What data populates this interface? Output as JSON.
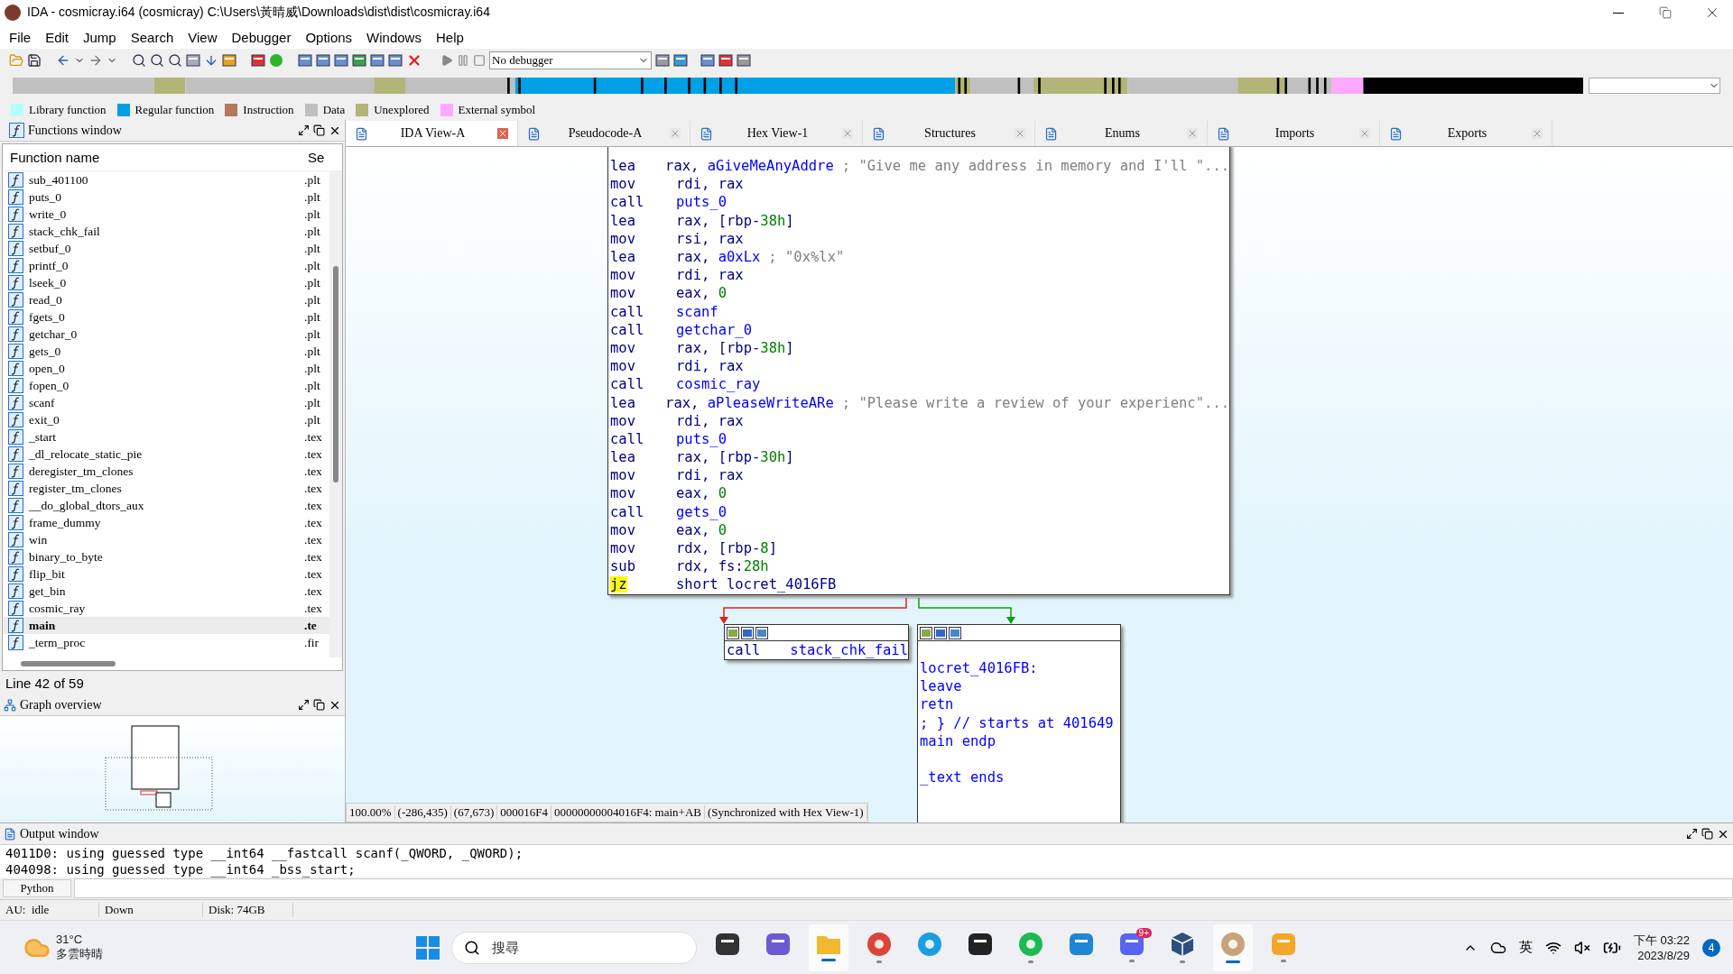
{
  "window": {
    "title": "IDA - cosmicray.i64 (cosmicray) C:\\Users\\黃晴威\\Downloads\\dist\\dist\\cosmicray.i64"
  },
  "menu": [
    "File",
    "Edit",
    "Jump",
    "Search",
    "View",
    "Debugger",
    "Options",
    "Windows",
    "Help"
  ],
  "toolbar": {
    "debugger": "No debugger"
  },
  "legend": [
    {
      "label": "Library function",
      "color": "#b4ffff"
    },
    {
      "label": "Regular function",
      "color": "#00a0e6"
    },
    {
      "label": "Instruction",
      "color": "#b4785a"
    },
    {
      "label": "Data",
      "color": "#c0c0c0"
    },
    {
      "label": "Unexplored",
      "color": "#b4b478"
    },
    {
      "label": "External symbol",
      "color": "#ffa8ff"
    }
  ],
  "functions_window": {
    "title": "Functions window",
    "columns": [
      "Function name",
      "Se"
    ],
    "rows": [
      {
        "name": "sub_401100",
        "segment": ".plt",
        "selected": false
      },
      {
        "name": "puts_0",
        "segment": ".plt",
        "selected": false
      },
      {
        "name": "write_0",
        "segment": ".plt",
        "selected": false
      },
      {
        "name": "stack_chk_fail",
        "segment": ".plt",
        "selected": false
      },
      {
        "name": "setbuf_0",
        "segment": ".plt",
        "selected": false
      },
      {
        "name": "printf_0",
        "segment": ".plt",
        "selected": false
      },
      {
        "name": "lseek_0",
        "segment": ".plt",
        "selected": false
      },
      {
        "name": "read_0",
        "segment": ".plt",
        "selected": false
      },
      {
        "name": "fgets_0",
        "segment": ".plt",
        "selected": false
      },
      {
        "name": "getchar_0",
        "segment": ".plt",
        "selected": false
      },
      {
        "name": "gets_0",
        "segment": ".plt",
        "selected": false
      },
      {
        "name": "open_0",
        "segment": ".plt",
        "selected": false
      },
      {
        "name": "fopen_0",
        "segment": ".plt",
        "selected": false
      },
      {
        "name": "scanf",
        "segment": ".plt",
        "selected": false
      },
      {
        "name": "exit_0",
        "segment": ".plt",
        "selected": false
      },
      {
        "name": "_start",
        "segment": ".tex",
        "selected": false
      },
      {
        "name": "_dl_relocate_static_pie",
        "segment": ".tex",
        "selected": false
      },
      {
        "name": "deregister_tm_clones",
        "segment": ".tex",
        "selected": false
      },
      {
        "name": "register_tm_clones",
        "segment": ".tex",
        "selected": false
      },
      {
        "name": "__do_global_dtors_aux",
        "segment": ".tex",
        "selected": false
      },
      {
        "name": "frame_dummy",
        "segment": ".tex",
        "selected": false
      },
      {
        "name": "win",
        "segment": ".tex",
        "selected": false
      },
      {
        "name": "binary_to_byte",
        "segment": ".tex",
        "selected": false
      },
      {
        "name": "flip_bit",
        "segment": ".tex",
        "selected": false
      },
      {
        "name": "get_bin",
        "segment": ".tex",
        "selected": false
      },
      {
        "name": "cosmic_ray",
        "segment": ".tex",
        "selected": false
      },
      {
        "name": "main",
        "segment": ".te",
        "selected": true
      },
      {
        "name": "_term_proc",
        "segment": ".fir",
        "selected": false
      }
    ],
    "status": "Line 42 of 59"
  },
  "graph_overview": {
    "title": "Graph overview"
  },
  "tabs": [
    {
      "label": "IDA View-A",
      "selected": true
    },
    {
      "label": "Pseudocode-A",
      "selected": false
    },
    {
      "label": "Hex View-1",
      "selected": false
    },
    {
      "label": "Structures",
      "selected": false
    },
    {
      "label": "Enums",
      "selected": false
    },
    {
      "label": "Imports",
      "selected": false
    },
    {
      "label": "Exports",
      "selected": false
    }
  ],
  "graph": {
    "main_block": {
      "lines": [
        {
          "op": "lea",
          "args": [
            {
              "text": "rax, ",
              "kind": "plain"
            },
            {
              "text": "aGiveMeAnyAddre",
              "kind": "name"
            }
          ],
          "comment": "; \"Give me any address in memory and I'll \"...",
          "highlighted": false
        },
        {
          "op": "mov",
          "args": [
            {
              "text": "rdi, rax",
              "kind": "plain"
            }
          ],
          "highlighted": false
        },
        {
          "op": "call",
          "args": [
            {
              "text": "puts_0",
              "kind": "name"
            }
          ],
          "highlighted": false
        },
        {
          "op": "lea",
          "args": [
            {
              "text": "rax, [rbp-",
              "kind": "plain"
            },
            {
              "text": "38h",
              "kind": "number"
            },
            {
              "text": "]",
              "kind": "plain"
            }
          ],
          "highlighted": false
        },
        {
          "op": "mov",
          "args": [
            {
              "text": "rsi, rax",
              "kind": "plain"
            }
          ],
          "highlighted": false
        },
        {
          "op": "lea",
          "args": [
            {
              "text": "rax, ",
              "kind": "plain"
            },
            {
              "text": "a0xLx",
              "kind": "name"
            }
          ],
          "comment": "; \"0x%lx\"",
          "highlighted": false
        },
        {
          "op": "mov",
          "args": [
            {
              "text": "rdi, rax",
              "kind": "plain"
            }
          ],
          "highlighted": false
        },
        {
          "op": "mov",
          "args": [
            {
              "text": "eax, ",
              "kind": "plain"
            },
            {
              "text": "0",
              "kind": "number"
            }
          ],
          "highlighted": false
        },
        {
          "op": "call",
          "args": [
            {
              "text": "scanf",
              "kind": "name"
            }
          ],
          "highlighted": false
        },
        {
          "op": "call",
          "args": [
            {
              "text": "getchar_0",
              "kind": "name"
            }
          ],
          "highlighted": false
        },
        {
          "op": "mov",
          "args": [
            {
              "text": "rax, [rbp-",
              "kind": "plain"
            },
            {
              "text": "38h",
              "kind": "number"
            },
            {
              "text": "]",
              "kind": "plain"
            }
          ],
          "highlighted": false
        },
        {
          "op": "mov",
          "args": [
            {
              "text": "rdi, rax",
              "kind": "plain"
            }
          ],
          "highlighted": false
        },
        {
          "op": "call",
          "args": [
            {
              "text": "cosmic_ray",
              "kind": "name"
            }
          ],
          "highlighted": false
        },
        {
          "op": "lea",
          "args": [
            {
              "text": "rax, ",
              "kind": "plain"
            },
            {
              "text": "aPleaseWriteARe",
              "kind": "name"
            }
          ],
          "comment": "; \"Please write a review of your experienc\"...",
          "highlighted": false
        },
        {
          "op": "mov",
          "args": [
            {
              "text": "rdi, rax",
              "kind": "plain"
            }
          ],
          "highlighted": false
        },
        {
          "op": "call",
          "args": [
            {
              "text": "puts_0",
              "kind": "name"
            }
          ],
          "highlighted": false
        },
        {
          "op": "lea",
          "args": [
            {
              "text": "rax, [rbp-",
              "kind": "plain"
            },
            {
              "text": "30h",
              "kind": "number"
            },
            {
              "text": "]",
              "kind": "plain"
            }
          ],
          "highlighted": false
        },
        {
          "op": "mov",
          "args": [
            {
              "text": "rdi, rax",
              "kind": "plain"
            }
          ],
          "highlighted": false
        },
        {
          "op": "mov",
          "args": [
            {
              "text": "eax, ",
              "kind": "plain"
            },
            {
              "text": "0",
              "kind": "number"
            }
          ],
          "highlighted": false
        },
        {
          "op": "call",
          "args": [
            {
              "text": "gets_0",
              "kind": "name"
            }
          ],
          "highlighted": false
        },
        {
          "op": "mov",
          "args": [
            {
              "text": "eax, ",
              "kind": "plain"
            },
            {
              "text": "0",
              "kind": "number"
            }
          ],
          "highlighted": false
        },
        {
          "op": "mov",
          "args": [
            {
              "text": "rdx, [rbp-",
              "kind": "plain"
            },
            {
              "text": "8",
              "kind": "number"
            },
            {
              "text": "]",
              "kind": "plain"
            }
          ],
          "highlighted": false
        },
        {
          "op": "sub",
          "args": [
            {
              "text": "rdx, fs:",
              "kind": "plain"
            },
            {
              "text": "28h",
              "kind": "number"
            }
          ],
          "highlighted": false
        },
        {
          "op": "jz",
          "args": [
            {
              "text": "short locret_4016FB",
              "kind": "plain"
            }
          ],
          "highlighted": true
        }
      ]
    },
    "fail_block": {
      "op": "call",
      "arg": "stack_chk_fail"
    },
    "ret_block": {
      "groups": [
        {
          "lines": [
            "locret_4016FB:",
            "leave",
            "retn",
            "; } // starts at 401649",
            "main endp"
          ]
        },
        {
          "lines": [
            "_text ends"
          ]
        }
      ]
    },
    "status": [
      "100.00%",
      "(-286,435)",
      "(67,673)",
      "000016F4",
      "00000000004016F4: main+AB",
      "(Synchronized with Hex View-1)"
    ]
  },
  "output_window": {
    "title": "Output window",
    "lines": [
      "4011D0: using guessed type __int64 __fastcall scanf(_QWORD, _QWORD);",
      "404098: using guessed type __int64 _bss_start;"
    ],
    "button": "Python"
  },
  "status_bar": [
    "AU:  idle",
    "Down",
    "Disk: 74GB"
  ],
  "taskbar": {
    "weather": {
      "temp": "31°C",
      "desc": "多雲時晴"
    },
    "search": {
      "placeholder": "搜尋"
    },
    "apps": [
      {
        "kind": "taskview",
        "running": false,
        "active": false
      },
      {
        "kind": "chat",
        "running": false,
        "active": false
      },
      {
        "kind": "files",
        "running": true,
        "active": true
      },
      {
        "kind": "chrome",
        "running": true,
        "active": false
      },
      {
        "kind": "edge",
        "running": false,
        "active": false
      },
      {
        "kind": "terminal",
        "running": false,
        "active": false
      },
      {
        "kind": "spotify",
        "running": true,
        "active": false
      },
      {
        "kind": "vscode",
        "running": false,
        "active": false
      },
      {
        "kind": "discord",
        "running": true,
        "active": false,
        "badge": "9+"
      },
      {
        "kind": "vbox",
        "running": true,
        "active": false
      },
      {
        "kind": "ida",
        "running": true,
        "active": true
      },
      {
        "kind": "sketch",
        "running": true,
        "active": false
      }
    ],
    "ime": "英",
    "time": "下午 03:22",
    "date": "2023/8/29",
    "notifications": "4"
  }
}
